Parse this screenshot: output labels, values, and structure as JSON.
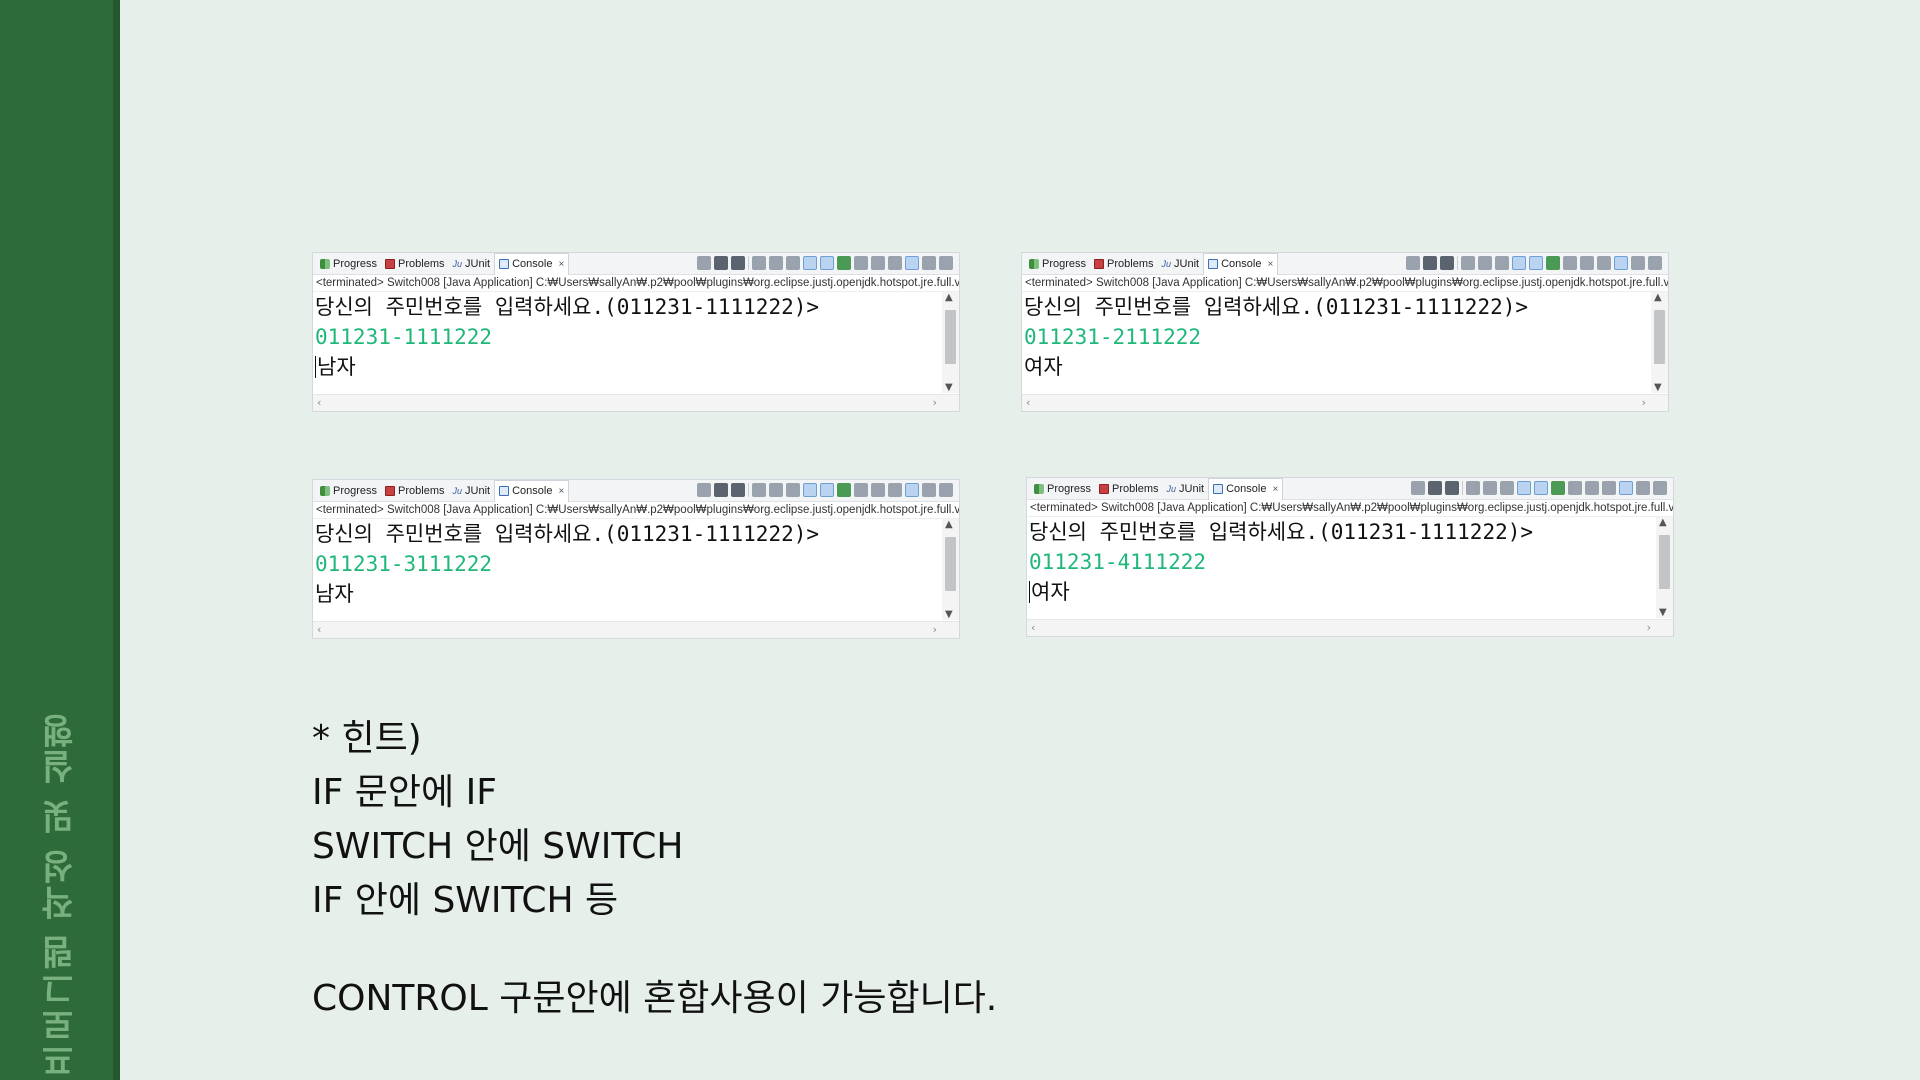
{
  "sidebar": {
    "title": "프로그램 작성 및 실행"
  },
  "tabs": {
    "progress": "Progress",
    "problems": "Problems",
    "junit": "JUnit",
    "console": "Console",
    "close": "×"
  },
  "consoles": [
    {
      "terminated": "<terminated> Switch008 [Java Application] C:₩Users₩sallyAn₩.p2₩pool₩plugins₩org.eclipse.justj.openjdk.hotspot.jre.full.v",
      "prompt": "당신의 주민번호를 입력하세요.(011231-1111222)>",
      "input": "011231-1111222",
      "output": "남자"
    },
    {
      "terminated": "<terminated> Switch008 [Java Application] C:₩Users₩sallyAn₩.p2₩pool₩plugins₩org.eclipse.justj.openjdk.hotspot.jre.full.v",
      "prompt": "당신의 주민번호를 입력하세요.(011231-1111222)>",
      "input": "011231-2111222",
      "output": "여자"
    },
    {
      "terminated": "<terminated> Switch008 [Java Application] C:₩Users₩sallyAn₩.p2₩pool₩plugins₩org.eclipse.justj.openjdk.hotspot.jre.full.v",
      "prompt": "당신의 주민번호를 입력하세요.(011231-1111222)>",
      "input": "011231-3111222",
      "output": "남자"
    },
    {
      "terminated": "<terminated> Switch008 [Java Application] C:₩Users₩sallyAn₩.p2₩pool₩plugins₩org.eclipse.justj.openjdk.hotspot.jre.full.v",
      "prompt": "당신의 주민번호를 입력하세요.(011231-1111222)>",
      "input": "011231-4111222",
      "output": "여자"
    }
  ],
  "hint": {
    "heading": "* 힌트)",
    "line1": "IF 문안에 IF",
    "line2": "SWITCH 안에 SWITCH",
    "line3": "IF 안에 SWITCH  등",
    "summary": "CONTROL 구문안에 혼합사용이 가능합니다."
  },
  "colors": {
    "background": "#e7efea",
    "sidebar": "#2e6b3a",
    "sidebar_text": "#78b07f",
    "console_input": "#1fb879"
  },
  "icons": {
    "progress": "progress-icon",
    "problems": "problems-icon",
    "junit": "junit-icon",
    "console": "console-icon"
  }
}
